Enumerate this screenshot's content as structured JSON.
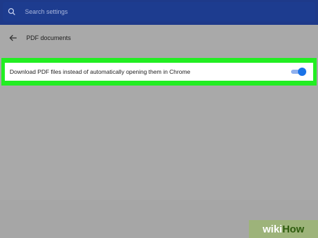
{
  "search": {
    "placeholder": "Search settings"
  },
  "page": {
    "title": "PDF documents"
  },
  "setting": {
    "label": "Download PDF files instead of automatically opening them in Chrome",
    "enabled": true
  },
  "colors": {
    "accent": "#1a73e8",
    "highlight": "#22ee22",
    "topbar": "#1e3a8a"
  },
  "icons": {
    "search": "search-icon",
    "back": "arrow-left-icon"
  },
  "watermark": {
    "wiki": "wiki",
    "how": "How"
  }
}
